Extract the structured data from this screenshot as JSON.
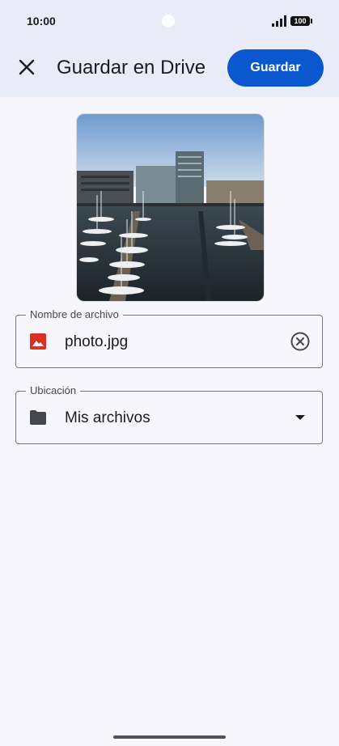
{
  "status_bar": {
    "time": "10:00",
    "battery": "100"
  },
  "header": {
    "title": "Guardar en Drive",
    "save_label": "Guardar"
  },
  "filename_field": {
    "label": "Nombre de archivo",
    "value": "photo.jpg",
    "icon": "image-icon",
    "action_icon": "clear-icon"
  },
  "location_field": {
    "label": "Ubicación",
    "value": "Mis archivos",
    "icon": "folder-icon",
    "action_icon": "dropdown-arrow-icon"
  },
  "colors": {
    "accent": "#0b57d0",
    "image_icon": "#d93025",
    "background": "#f7f6fd",
    "header_background": "#e9ecf8"
  }
}
